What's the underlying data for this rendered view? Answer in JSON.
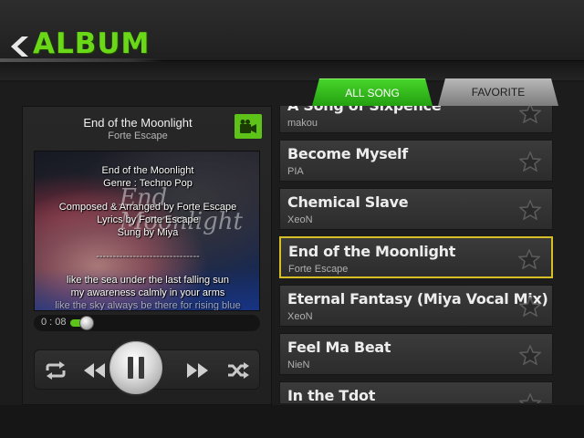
{
  "header": {
    "title": "ALBUM",
    "back_icon": "back-arrow-icon"
  },
  "tabs": [
    {
      "label": "ALL SONG",
      "active": true,
      "color": "#35c11d"
    },
    {
      "label": "FAVORITE",
      "active": false,
      "color": "#a0a0a0"
    }
  ],
  "now_playing": {
    "title": "End of the Moonlight",
    "artist": "Forte Escape",
    "video_icon": "video-camera-icon",
    "info_lines": [
      "End of the Moonlight",
      "Genre : Techno Pop",
      "",
      "Composed & Arranged by Forte Escape",
      "Lyrics by Forte Escape",
      "Sung by Miya",
      "",
      "-------------------------------",
      "",
      "like the sea under the last falling sun",
      "my awareness calmly in your arms",
      "like the sky always be there for rising blue"
    ],
    "art_overlay_text": "End\nMoonlight",
    "elapsed": "0 : 08",
    "progress_fraction": 0.04
  },
  "controls": {
    "repeat_icon": "repeat-icon",
    "prev_icon": "previous-icon",
    "pause_icon": "pause-icon",
    "next_icon": "next-icon",
    "shuffle_icon": "shuffle-icon"
  },
  "songs": [
    {
      "title": "A Song of Sixpence",
      "artist": "makou",
      "favorite": false,
      "selected": false
    },
    {
      "title": "Become Myself",
      "artist": "PIA",
      "favorite": false,
      "selected": false
    },
    {
      "title": "Chemical Slave",
      "artist": "XeoN",
      "favorite": false,
      "selected": false
    },
    {
      "title": "End of the Moonlight",
      "artist": "Forte Escape",
      "favorite": false,
      "selected": true
    },
    {
      "title": "Eternal Fantasy (Miya Vocal Mix)",
      "artist": "XeoN",
      "favorite": false,
      "selected": false
    },
    {
      "title": "Feel Ma Beat",
      "artist": "NieN",
      "favorite": false,
      "selected": false
    },
    {
      "title": "In the Tdot",
      "artist": "",
      "favorite": false,
      "selected": false
    }
  ],
  "colors": {
    "accent": "#6ad818",
    "selected_border": "#d6bf26"
  }
}
